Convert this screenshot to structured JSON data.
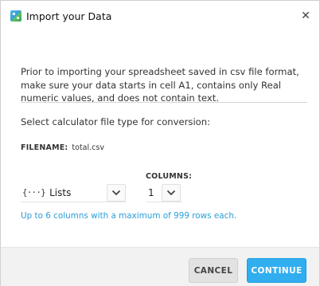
{
  "window": {
    "title": "Import your Data",
    "close_symbol": "✕",
    "app_icon": "calculator-app-icon"
  },
  "intro": {
    "text": "Prior to importing your spreadsheet saved in csv file format, make sure your data starts in cell A1, contains only Real numeric values, and does not contain text."
  },
  "conversion": {
    "label": "Select calculator file type for conversion:",
    "filename_key": "FILENAME:",
    "filename_value": "total.csv",
    "file_type": {
      "icon": "{···}",
      "value": "Lists"
    },
    "columns": {
      "label": "COLUMNS:",
      "value": "1"
    },
    "hint": "Up to 6 columns with a maximum of 999 rows each."
  },
  "footer": {
    "cancel_label": "CANCEL",
    "continue_label": "CONTINUE"
  },
  "colors": {
    "accent": "#31aef0",
    "hint": "#2a9fd8",
    "footer_bg": "#f2f2f2"
  }
}
